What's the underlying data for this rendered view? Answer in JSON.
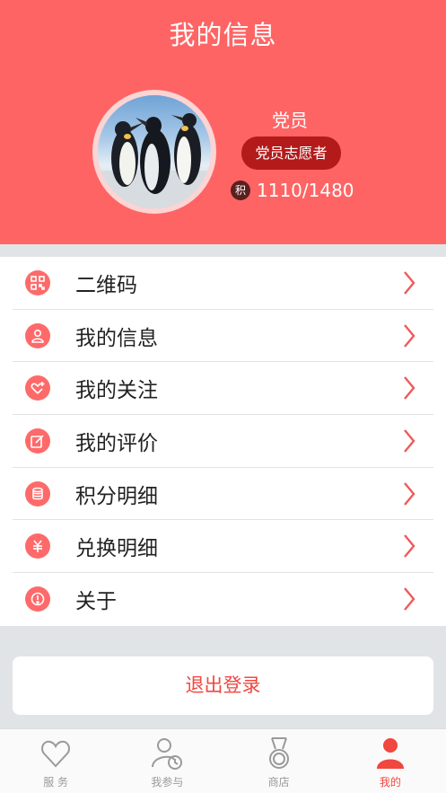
{
  "header": {
    "title": "我的信息"
  },
  "profile": {
    "role": "党员",
    "badge": "党员志愿者",
    "points_icon": "积",
    "points": "1110/1480",
    "avatar_icon": "penguins-photo"
  },
  "menu": {
    "items": [
      {
        "label": "二维码",
        "icon": "qr-code-icon"
      },
      {
        "label": "我的信息",
        "icon": "user-icon"
      },
      {
        "label": "我的关注",
        "icon": "heart-plus-icon"
      },
      {
        "label": "我的评价",
        "icon": "edit-icon"
      },
      {
        "label": "积分明细",
        "icon": "coin-stack-icon"
      },
      {
        "label": "兑换明细",
        "icon": "yen-exchange-icon"
      },
      {
        "label": "关于",
        "icon": "info-icon"
      }
    ]
  },
  "logout": {
    "label": "退出登录"
  },
  "tabbar": {
    "tabs": [
      {
        "label": "服 务",
        "icon": "heart-icon",
        "active": false
      },
      {
        "label": "我参与",
        "icon": "user-clock-icon",
        "active": false
      },
      {
        "label": "商店",
        "icon": "medal-icon",
        "active": false
      },
      {
        "label": "我的",
        "icon": "person-icon",
        "active": true
      }
    ]
  },
  "colors": {
    "brand": "#ff6464",
    "badge": "#b31b1b",
    "accent_text": "#f0473f",
    "menu_icon": "#fe6a6a"
  }
}
